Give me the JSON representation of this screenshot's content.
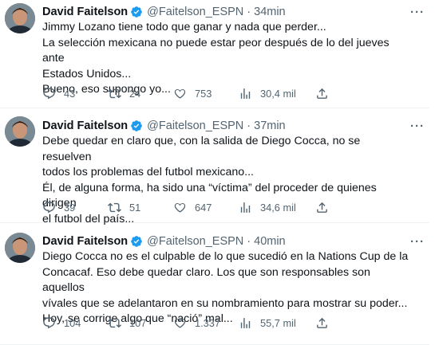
{
  "author": {
    "name": "David Faitelson",
    "handle": "@Faitelson_ESPN"
  },
  "tweets": [
    {
      "time": "34min",
      "lines": [
        "Jimmy Lozano tiene todo que ganar y nada que perder...",
        "La selección mexicana no puede estar peor después de lo del jueves ante",
        "Estados Unidos...",
        "Bueno, eso supongo yo..."
      ],
      "replies": "43",
      "retweets": "24",
      "likes": "753",
      "views": "30,4 mil"
    },
    {
      "time": "37min",
      "lines": [
        "Debe quedar en claro que, con la salida de Diego Cocca, no se resuelven",
        "todos los problemas del futbol mexicano...",
        "Él, de alguna forma, ha sido una “víctima” del proceder de quienes dirigen",
        "el futbol del país..."
      ],
      "replies": "39",
      "retweets": "51",
      "likes": "647",
      "views": "34,6 mil"
    },
    {
      "time": "40min",
      "lines": [
        "Diego Cocca no es el culpable de lo que sucedió en la Nations Cup de la",
        "Concacaf. Eso debe quedar claro. Los que son responsables son aquellos",
        "vívales que se adelantaron en su nombramiento para mostrar su poder...",
        "Hoy, se corrige algo que “nació” mal..."
      ],
      "replies": "104",
      "retweets": "107",
      "likes": "1.337",
      "views": "55,7 mil"
    }
  ],
  "icons": {
    "verified": "verified-badge-icon",
    "more": "more-dots-icon",
    "reply": "reply-icon",
    "retweet": "retweet-icon",
    "like": "heart-icon",
    "views": "views-bar-icon",
    "share": "share-icon"
  },
  "colors": {
    "verified": "#1d9bf0",
    "text": "#0f1419",
    "muted": "#536471"
  }
}
